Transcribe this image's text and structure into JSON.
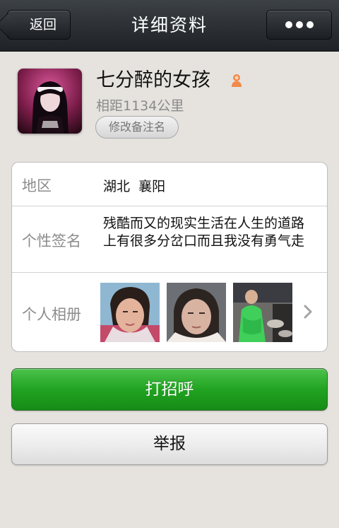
{
  "header": {
    "back_label": "返回",
    "title": "详细资料",
    "more_icon": "more-dots-icon"
  },
  "profile": {
    "nickname": "七分醉的女孩",
    "gender_icon": "female-icon",
    "distance": "相距1134公里",
    "remark_button": "修改备注名"
  },
  "details": {
    "region_label": "地区",
    "region_value": "湖北  襄阳",
    "signature_label": "个性签名",
    "signature_value": "残酷而又的现实生活在人生的道路上有很多分岔口而且我没有勇气走",
    "album_label": "个人相册",
    "album_arrow_icon": "chevron-right-icon"
  },
  "actions": {
    "greet_label": "打招呼",
    "report_label": "举报"
  },
  "colors": {
    "titlebar": "#2a2e32",
    "background": "#e6e3df",
    "greet_button": "#21a321",
    "gender_icon": "#f08a4b"
  }
}
